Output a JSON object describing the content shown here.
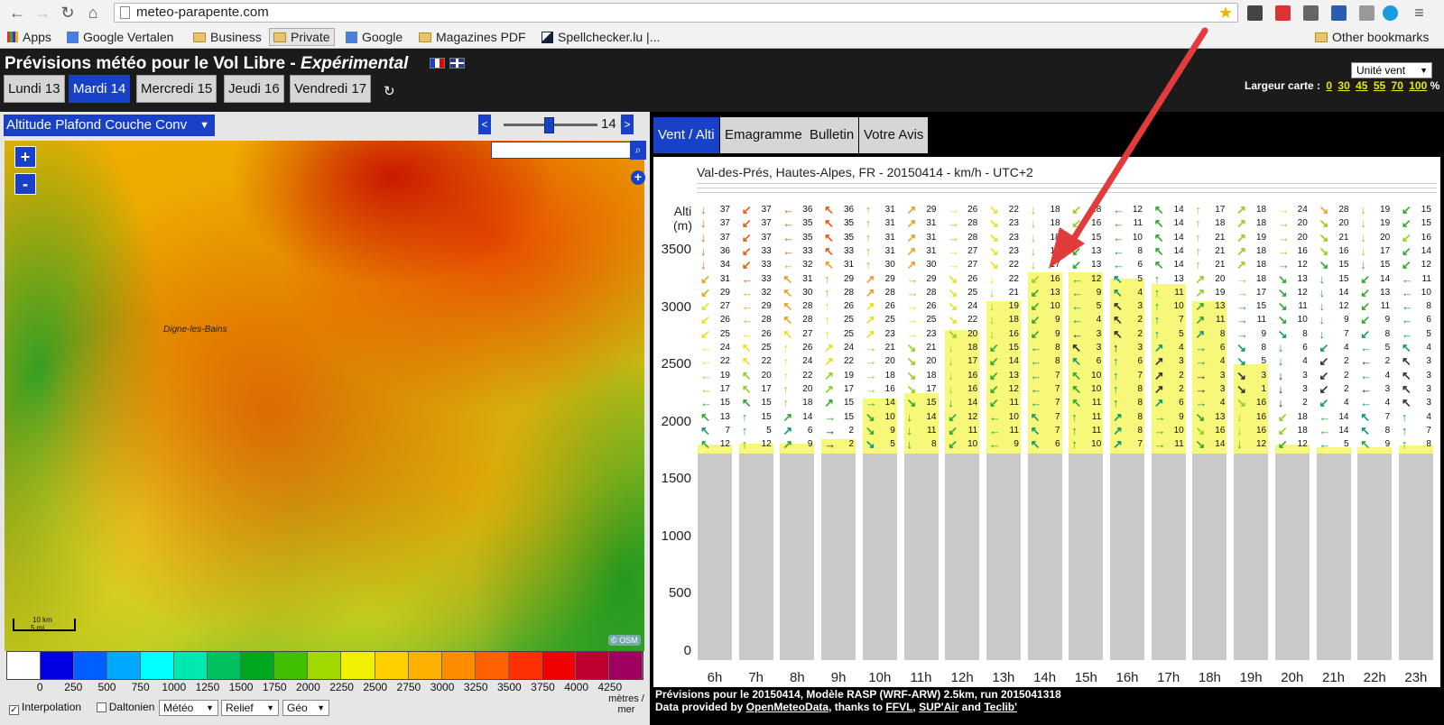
{
  "browser": {
    "url": "meteo-parapente.com",
    "bookmarks": [
      {
        "label": "Apps",
        "type": "apps"
      },
      {
        "label": "Google Vertalen",
        "type": "link"
      },
      {
        "label": "Business",
        "type": "folder"
      },
      {
        "label": "Private",
        "type": "folder"
      },
      {
        "label": "Google",
        "type": "link"
      },
      {
        "label": "Magazines PDF",
        "type": "folder"
      },
      {
        "label": "Spellchecker.lu |...",
        "type": "link"
      }
    ],
    "other_bookmarks": "Other bookmarks"
  },
  "site": {
    "title": "Prévisions météo pour le Vol Libre -",
    "title_em": "Expérimental",
    "days": [
      "Lundi 13",
      "Mardi 14",
      "Mercredi 15",
      "Jeudi 16",
      "Vendredi 17"
    ],
    "active_day": 1,
    "unit_select": "Unité vent",
    "width_label": "Largeur carte :",
    "width_options": [
      "0",
      "30",
      "45",
      "55",
      "70",
      "100"
    ],
    "width_suffix": "%"
  },
  "map": {
    "layer": "Altitude Plafond Couche Conv",
    "hour": "14 h",
    "hour_fraction": 0.47,
    "town": "Digne-les-Bains",
    "scale_top": "10 km",
    "scale_bottom": "5 mi",
    "attribution": "© OSM",
    "legend_colors": [
      "#ffffff",
      "#0000e0",
      "#0060ff",
      "#00a8ff",
      "#00ffff",
      "#00e8b0",
      "#00c060",
      "#00a820",
      "#40c000",
      "#a0d800",
      "#f0f000",
      "#ffd000",
      "#ffb000",
      "#ff8c00",
      "#ff6000",
      "#ff3000",
      "#f00000",
      "#c00030",
      "#a00060"
    ],
    "legend_labels": [
      "0",
      "250",
      "500",
      "750",
      "1000",
      "1250",
      "1500",
      "1750",
      "2000",
      "2250",
      "2500",
      "2750",
      "3000",
      "3250",
      "3500",
      "3750",
      "4000",
      "4250"
    ],
    "legend_unit": "mètres / mer",
    "interpolation_label": "Interpolation",
    "interpolation_checked": true,
    "daltonien_label": "Daltonien",
    "daltonien_checked": false,
    "selects": [
      "Météo",
      "Relief",
      "Géo"
    ]
  },
  "panel": {
    "tabs": [
      "Vent / Alti",
      "Emagramme",
      "Bulletin",
      "Votre Avis"
    ],
    "active_tab": 0,
    "location": "Val-des-Prés, Hautes-Alpes, FR - 20150414 - km/h - UTC+2",
    "alti_label": "Alti",
    "alti_unit": "(m)",
    "y_ticks": [
      "3500",
      "3000",
      "2500",
      "2000",
      "1500",
      "1000",
      "500",
      "0"
    ],
    "hours": [
      "6h",
      "7h",
      "8h",
      "9h",
      "10h",
      "11h",
      "12h",
      "13h",
      "14h",
      "15h",
      "16h",
      "17h",
      "18h",
      "19h",
      "20h",
      "21h",
      "22h",
      "23h"
    ],
    "ceiling_m": [
      1800,
      1810,
      1810,
      1850,
      2200,
      2250,
      2800,
      3050,
      3300,
      3300,
      3250,
      3200,
      3050,
      2500,
      1800,
      1780,
      1780,
      1790
    ],
    "wind_top_speeds": [
      [
        37,
        37,
        37,
        36,
        34,
        31,
        29,
        27,
        26,
        25,
        24,
        22,
        19,
        17,
        15,
        13,
        7,
        12
      ],
      [
        37,
        37,
        37,
        33,
        33,
        33,
        32,
        29,
        28,
        26,
        25,
        22,
        20,
        17,
        15,
        15,
        5,
        12
      ],
      [
        36,
        35,
        35,
        33,
        32,
        31,
        30,
        28,
        28,
        27,
        26,
        24,
        22,
        20,
        18,
        14,
        6,
        9
      ],
      [
        36,
        35,
        35,
        33,
        31,
        29,
        28,
        26,
        25,
        25,
        24,
        22,
        19,
        17,
        15,
        15,
        2,
        2
      ],
      [
        31,
        31,
        31,
        31,
        30,
        29,
        28,
        26,
        25,
        23,
        21,
        20,
        18,
        16,
        14,
        10,
        9,
        5
      ],
      [
        29,
        31,
        31,
        31,
        30,
        29,
        28,
        26,
        25,
        23,
        21,
        20,
        18,
        17,
        15,
        14,
        11,
        8
      ],
      [
        26,
        28,
        28,
        27,
        27,
        26,
        25,
        24,
        22,
        20,
        18,
        17,
        16,
        16,
        14,
        12,
        11,
        10
      ],
      [
        22,
        23,
        23,
        23,
        22,
        22,
        21,
        19,
        18,
        16,
        15,
        14,
        13,
        12,
        11,
        10,
        11,
        9
      ],
      [
        18,
        18,
        18,
        18,
        17,
        16,
        13,
        10,
        9,
        9,
        8,
        8,
        7,
        7,
        7,
        7,
        7,
        6
      ],
      [
        18,
        16,
        15,
        13,
        13,
        12,
        9,
        5,
        4,
        3,
        3,
        6,
        10,
        10,
        11,
        11,
        11,
        10
      ],
      [
        12,
        11,
        10,
        8,
        6,
        5,
        4,
        3,
        2,
        2,
        3,
        6,
        7,
        8,
        8,
        8,
        8,
        7
      ],
      [
        14,
        14,
        14,
        14,
        14,
        13,
        11,
        10,
        7,
        5,
        4,
        3,
        2,
        2,
        6,
        9,
        10,
        11
      ],
      [
        17,
        18,
        21,
        21,
        21,
        20,
        19,
        13,
        11,
        8,
        6,
        4,
        3,
        3,
        4,
        13,
        16,
        14
      ],
      [
        18,
        18,
        19,
        18,
        18,
        18,
        17,
        15,
        11,
        9,
        8,
        5,
        3,
        1,
        16,
        16,
        16,
        12
      ],
      [
        24,
        20,
        20,
        16,
        12,
        13,
        12,
        11,
        10,
        8,
        6,
        4,
        3,
        3,
        2,
        18,
        18,
        12
      ],
      [
        28,
        20,
        21,
        16,
        15,
        15,
        14,
        12,
        9,
        7,
        4,
        2,
        2,
        2,
        4,
        14,
        14,
        5
      ],
      [
        19,
        19,
        20,
        17,
        15,
        14,
        13,
        11,
        9,
        8,
        5,
        2,
        4,
        3,
        4,
        7,
        8,
        9
      ],
      [
        15,
        15,
        16,
        14,
        12,
        11,
        10,
        8,
        6,
        5,
        4,
        3,
        3,
        3,
        3,
        4,
        7,
        8
      ]
    ],
    "footer_line1": "Prévisions pour le 20150414, Modèle RASP (WRF-ARW) 2.5km, run 2015041318",
    "footer_data": "Data provided by",
    "footer_omd": "OpenMeteoData",
    "footer_thanks": ", thanks to",
    "footer_ffvl": "FFVL",
    "footer_supair": "SUP'Air",
    "footer_and": "and",
    "footer_teclib": "Teclib'"
  }
}
